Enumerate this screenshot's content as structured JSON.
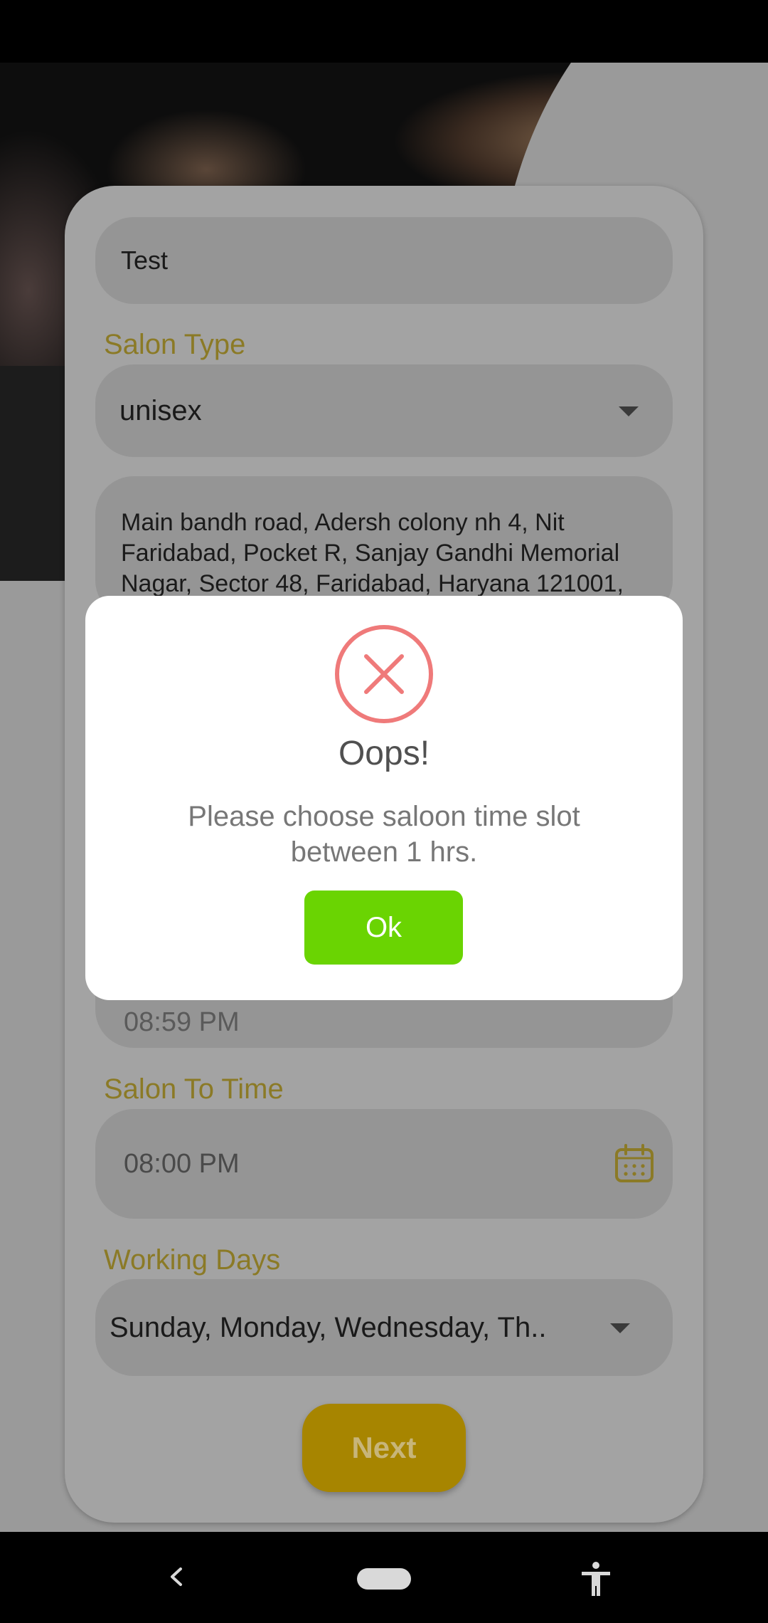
{
  "form": {
    "salon_name_value": "Test",
    "salon_type_label": "Salon Type",
    "salon_type_value": "unisex",
    "address_value": "Main bandh road, Adersh colony nh 4, Nit Faridabad, Pocket R, Sanjay Gandhi Memorial Nagar, Sector 48, Faridabad, Haryana 121001,",
    "from_time_value_partial": "08:59 PM",
    "to_time_label": "Salon To Time",
    "to_time_value": "08:00 PM",
    "working_days_label": "Working Days",
    "working_days_value": "Sunday, Monday, Wednesday, Th..",
    "next_label": "Next"
  },
  "dialog": {
    "title": "Oops!",
    "message": "Please choose saloon time slot between 1 hrs.",
    "ok_label": "Ok"
  },
  "icons": {
    "error": "close-circle-icon",
    "calendar": "calendar-icon",
    "dropdown": "chevron-down-icon",
    "nav_back": "back-icon",
    "nav_home": "home-pill-icon",
    "nav_accessibility": "accessibility-icon"
  },
  "colors": {
    "accent_gold": "#a78500",
    "label_gold": "#8b7a26",
    "ok_green": "#6ad402",
    "error_red": "#ef7a7a"
  }
}
